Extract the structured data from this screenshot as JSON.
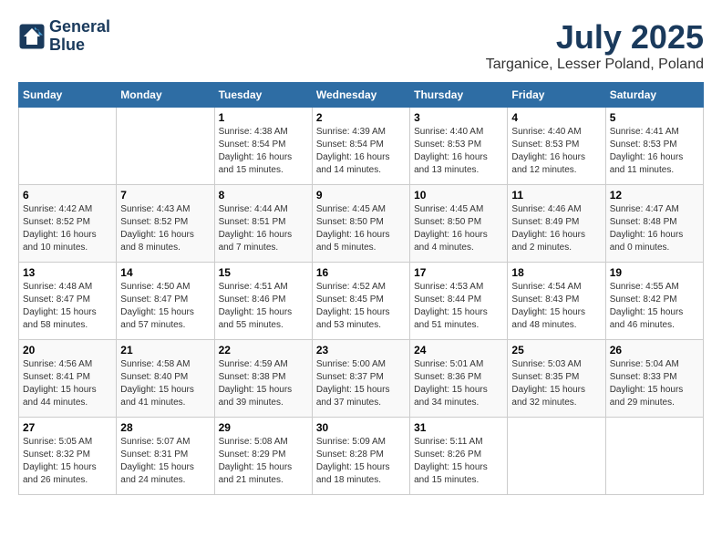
{
  "header": {
    "logo_line1": "General",
    "logo_line2": "Blue",
    "month": "July 2025",
    "location": "Targanice, Lesser Poland, Poland"
  },
  "days_of_week": [
    "Sunday",
    "Monday",
    "Tuesday",
    "Wednesday",
    "Thursday",
    "Friday",
    "Saturday"
  ],
  "weeks": [
    [
      {
        "day": "",
        "info": ""
      },
      {
        "day": "",
        "info": ""
      },
      {
        "day": "1",
        "info": "Sunrise: 4:38 AM\nSunset: 8:54 PM\nDaylight: 16 hours\nand 15 minutes."
      },
      {
        "day": "2",
        "info": "Sunrise: 4:39 AM\nSunset: 8:54 PM\nDaylight: 16 hours\nand 14 minutes."
      },
      {
        "day": "3",
        "info": "Sunrise: 4:40 AM\nSunset: 8:53 PM\nDaylight: 16 hours\nand 13 minutes."
      },
      {
        "day": "4",
        "info": "Sunrise: 4:40 AM\nSunset: 8:53 PM\nDaylight: 16 hours\nand 12 minutes."
      },
      {
        "day": "5",
        "info": "Sunrise: 4:41 AM\nSunset: 8:53 PM\nDaylight: 16 hours\nand 11 minutes."
      }
    ],
    [
      {
        "day": "6",
        "info": "Sunrise: 4:42 AM\nSunset: 8:52 PM\nDaylight: 16 hours\nand 10 minutes."
      },
      {
        "day": "7",
        "info": "Sunrise: 4:43 AM\nSunset: 8:52 PM\nDaylight: 16 hours\nand 8 minutes."
      },
      {
        "day": "8",
        "info": "Sunrise: 4:44 AM\nSunset: 8:51 PM\nDaylight: 16 hours\nand 7 minutes."
      },
      {
        "day": "9",
        "info": "Sunrise: 4:45 AM\nSunset: 8:50 PM\nDaylight: 16 hours\nand 5 minutes."
      },
      {
        "day": "10",
        "info": "Sunrise: 4:45 AM\nSunset: 8:50 PM\nDaylight: 16 hours\nand 4 minutes."
      },
      {
        "day": "11",
        "info": "Sunrise: 4:46 AM\nSunset: 8:49 PM\nDaylight: 16 hours\nand 2 minutes."
      },
      {
        "day": "12",
        "info": "Sunrise: 4:47 AM\nSunset: 8:48 PM\nDaylight: 16 hours\nand 0 minutes."
      }
    ],
    [
      {
        "day": "13",
        "info": "Sunrise: 4:48 AM\nSunset: 8:47 PM\nDaylight: 15 hours\nand 58 minutes."
      },
      {
        "day": "14",
        "info": "Sunrise: 4:50 AM\nSunset: 8:47 PM\nDaylight: 15 hours\nand 57 minutes."
      },
      {
        "day": "15",
        "info": "Sunrise: 4:51 AM\nSunset: 8:46 PM\nDaylight: 15 hours\nand 55 minutes."
      },
      {
        "day": "16",
        "info": "Sunrise: 4:52 AM\nSunset: 8:45 PM\nDaylight: 15 hours\nand 53 minutes."
      },
      {
        "day": "17",
        "info": "Sunrise: 4:53 AM\nSunset: 8:44 PM\nDaylight: 15 hours\nand 51 minutes."
      },
      {
        "day": "18",
        "info": "Sunrise: 4:54 AM\nSunset: 8:43 PM\nDaylight: 15 hours\nand 48 minutes."
      },
      {
        "day": "19",
        "info": "Sunrise: 4:55 AM\nSunset: 8:42 PM\nDaylight: 15 hours\nand 46 minutes."
      }
    ],
    [
      {
        "day": "20",
        "info": "Sunrise: 4:56 AM\nSunset: 8:41 PM\nDaylight: 15 hours\nand 44 minutes."
      },
      {
        "day": "21",
        "info": "Sunrise: 4:58 AM\nSunset: 8:40 PM\nDaylight: 15 hours\nand 41 minutes."
      },
      {
        "day": "22",
        "info": "Sunrise: 4:59 AM\nSunset: 8:38 PM\nDaylight: 15 hours\nand 39 minutes."
      },
      {
        "day": "23",
        "info": "Sunrise: 5:00 AM\nSunset: 8:37 PM\nDaylight: 15 hours\nand 37 minutes."
      },
      {
        "day": "24",
        "info": "Sunrise: 5:01 AM\nSunset: 8:36 PM\nDaylight: 15 hours\nand 34 minutes."
      },
      {
        "day": "25",
        "info": "Sunrise: 5:03 AM\nSunset: 8:35 PM\nDaylight: 15 hours\nand 32 minutes."
      },
      {
        "day": "26",
        "info": "Sunrise: 5:04 AM\nSunset: 8:33 PM\nDaylight: 15 hours\nand 29 minutes."
      }
    ],
    [
      {
        "day": "27",
        "info": "Sunrise: 5:05 AM\nSunset: 8:32 PM\nDaylight: 15 hours\nand 26 minutes."
      },
      {
        "day": "28",
        "info": "Sunrise: 5:07 AM\nSunset: 8:31 PM\nDaylight: 15 hours\nand 24 minutes."
      },
      {
        "day": "29",
        "info": "Sunrise: 5:08 AM\nSunset: 8:29 PM\nDaylight: 15 hours\nand 21 minutes."
      },
      {
        "day": "30",
        "info": "Sunrise: 5:09 AM\nSunset: 8:28 PM\nDaylight: 15 hours\nand 18 minutes."
      },
      {
        "day": "31",
        "info": "Sunrise: 5:11 AM\nSunset: 8:26 PM\nDaylight: 15 hours\nand 15 minutes."
      },
      {
        "day": "",
        "info": ""
      },
      {
        "day": "",
        "info": ""
      }
    ]
  ]
}
